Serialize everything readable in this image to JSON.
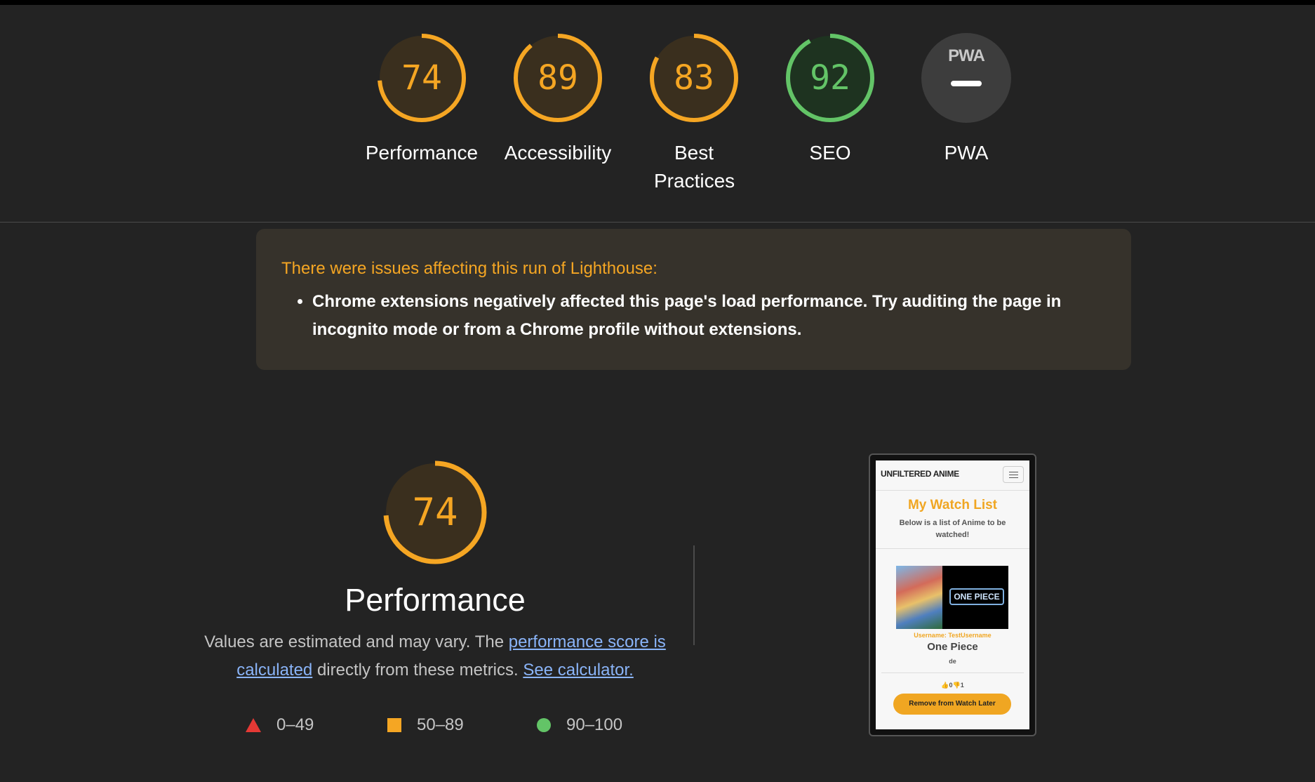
{
  "colors": {
    "average": "#f5a623",
    "pass": "#63c467",
    "fail": "#e53935",
    "na": "#3d3d3d"
  },
  "categories": [
    {
      "label": "Performance",
      "score": 74,
      "status": "average"
    },
    {
      "label": "Accessibility",
      "score": 89,
      "status": "average"
    },
    {
      "label": "Best Practices",
      "score": 83,
      "status": "average"
    },
    {
      "label": "SEO",
      "score": 92,
      "status": "pass"
    },
    {
      "label": "PWA",
      "badge": "PWA",
      "status": "na"
    }
  ],
  "warning": {
    "title": "There were issues affecting this run of Lighthouse:",
    "items": [
      "Chrome extensions negatively affected this page's load performance. Try auditing the page in incognito mode or from a Chrome profile without extensions."
    ]
  },
  "performance": {
    "score": 74,
    "title": "Performance",
    "desc_prefix": "Values are estimated and may vary. The ",
    "desc_link1": "performance score is calculated",
    "desc_mid": " directly from these metrics. ",
    "desc_link2": "See calculator."
  },
  "legend": [
    {
      "range": "0–49",
      "icon": "red-triangle-icon"
    },
    {
      "range": "50–89",
      "icon": "orange-square-icon"
    },
    {
      "range": "90–100",
      "icon": "green-circle-icon"
    }
  ],
  "thumbnail": {
    "brand": "UNFILTERED ANIME",
    "title": "My Watch List",
    "subtitle": "Below is a list of Anime to be watched!",
    "user": "Username: TestUsername",
    "anime": "One Piece",
    "detail": "de",
    "votes": "👍0👎1",
    "button": "Remove from Watch Later",
    "logo_text": "ONE PIECE"
  }
}
